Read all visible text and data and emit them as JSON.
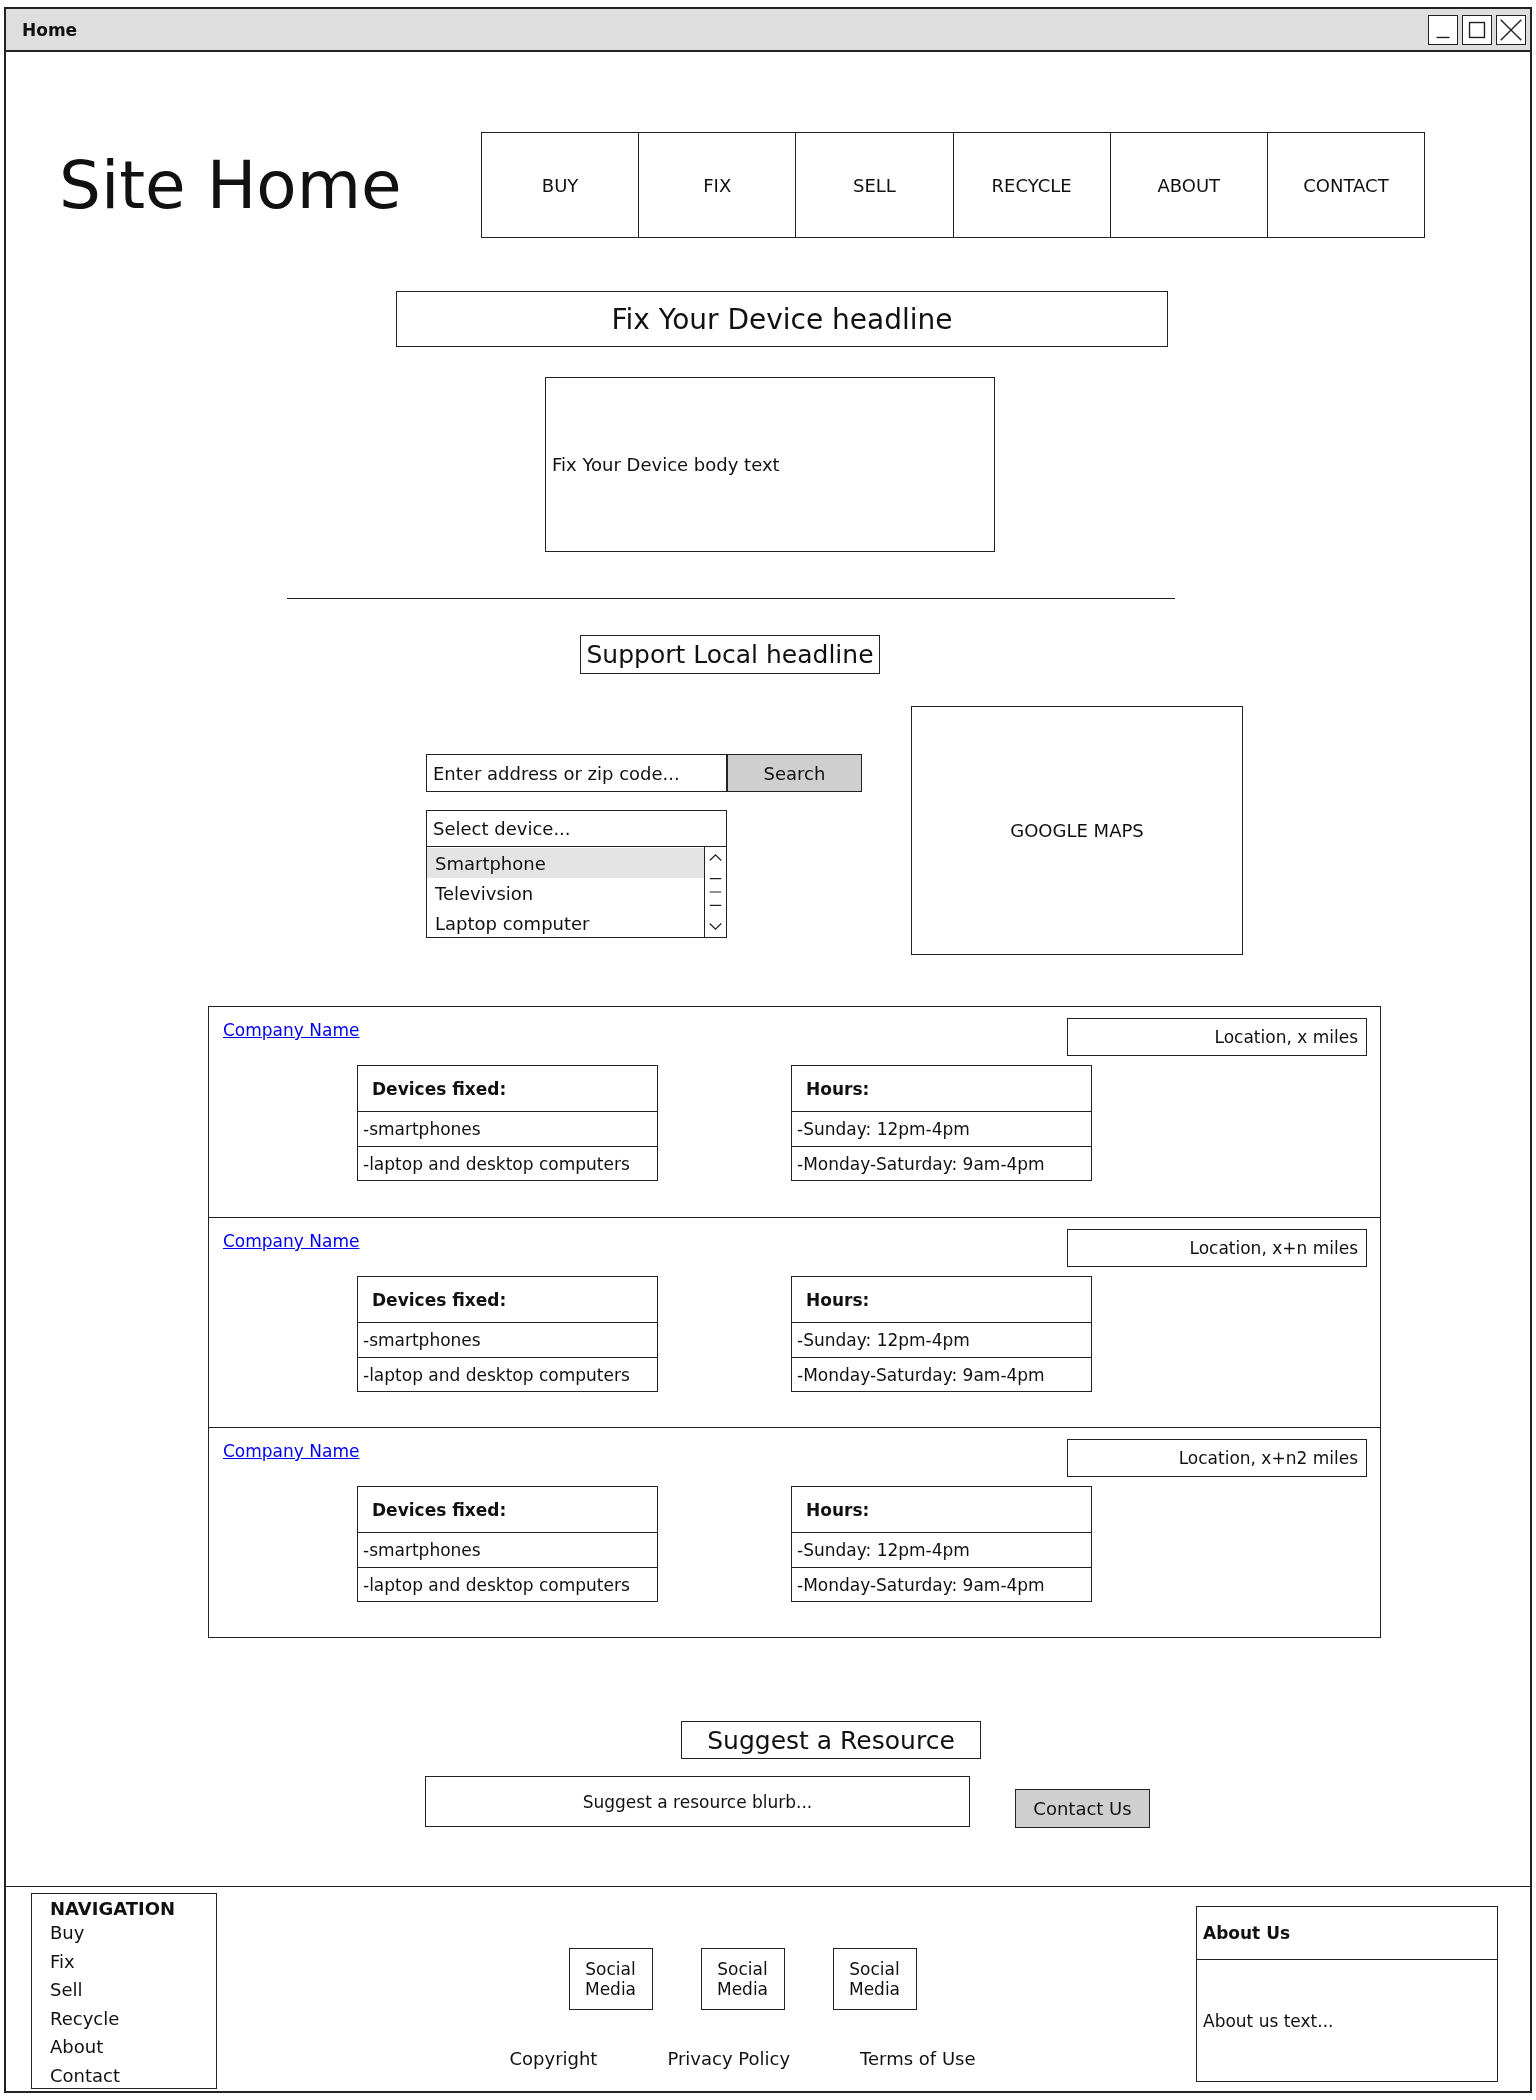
{
  "window": {
    "title": "Home"
  },
  "header": {
    "logo": "Site Home",
    "nav": [
      {
        "label": "BUY"
      },
      {
        "label": "FIX"
      },
      {
        "label": "SELL"
      },
      {
        "label": "RECYCLE"
      },
      {
        "label": "ABOUT"
      },
      {
        "label": "CONTACT"
      }
    ]
  },
  "fix_section": {
    "headline": "Fix Your Device headline",
    "body": "Fix Your Device body text"
  },
  "support_section": {
    "headline": "Support Local headline",
    "search": {
      "placeholder": "Enter address or zip code...",
      "button": "Search"
    },
    "device_select": {
      "placeholder": "Select device...",
      "options": [
        {
          "label": "Smartphone",
          "selected": true
        },
        {
          "label": "Televivsion",
          "selected": false
        },
        {
          "label": "Laptop computer",
          "selected": false
        }
      ]
    },
    "map": {
      "label": "GOOGLE MAPS"
    }
  },
  "companies": [
    {
      "name": "Company Name",
      "location": "Location, x miles",
      "devices": {
        "title": "Devices fixed:",
        "items": [
          "-smartphones",
          "-laptop and desktop computers"
        ]
      },
      "hours": {
        "title": "Hours:",
        "items": [
          "-Sunday: 12pm-4pm",
          "-Monday-Saturday: 9am-4pm"
        ]
      }
    },
    {
      "name": "Company Name",
      "location": "Location, x+n miles",
      "devices": {
        "title": "Devices fixed:",
        "items": [
          "-smartphones",
          "-laptop and desktop computers"
        ]
      },
      "hours": {
        "title": "Hours:",
        "items": [
          "-Sunday: 12pm-4pm",
          "-Monday-Saturday: 9am-4pm"
        ]
      }
    },
    {
      "name": "Company Name",
      "location": "Location, x+n2 miles",
      "devices": {
        "title": "Devices fixed:",
        "items": [
          "-smartphones",
          "-laptop and desktop computers"
        ]
      },
      "hours": {
        "title": "Hours:",
        "items": [
          "-Sunday: 12pm-4pm",
          "-Monday-Saturday: 9am-4pm"
        ]
      }
    }
  ],
  "suggest_section": {
    "headline": "Suggest a Resource",
    "blurb": "Suggest a resource blurb...",
    "button": "Contact Us"
  },
  "footer": {
    "navigation": {
      "title": "NAVIGATION",
      "items": [
        "Buy",
        "Fix",
        "Sell",
        "Recycle",
        "About",
        "Contact"
      ]
    },
    "social": [
      "Social Media",
      "Social Media",
      "Social Media"
    ],
    "links": [
      "Copyright",
      "Privacy Policy",
      "Terms of Use"
    ],
    "about": {
      "title": "About Us",
      "text": "About us text..."
    }
  }
}
